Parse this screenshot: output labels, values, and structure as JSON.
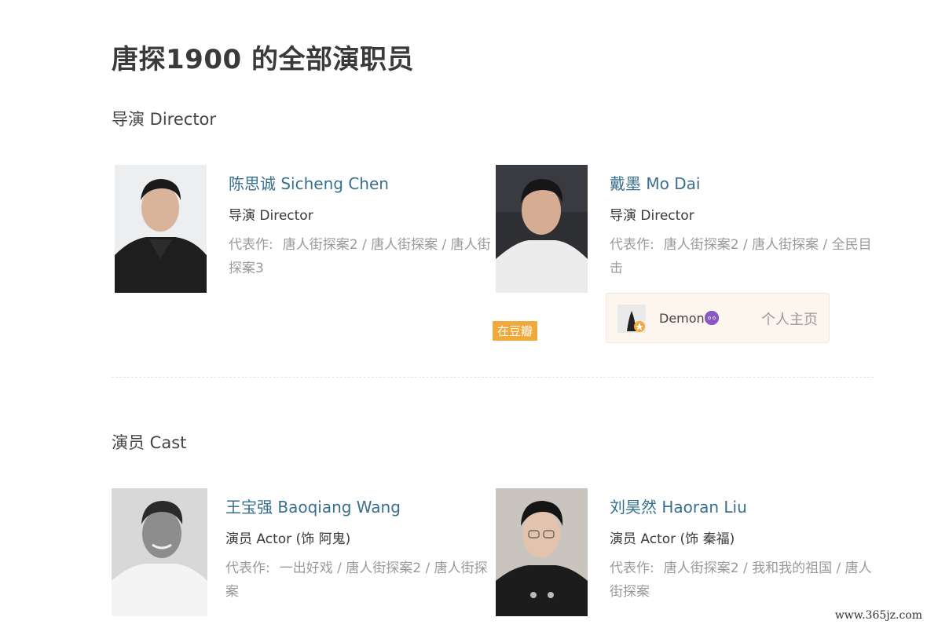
{
  "page": {
    "title": "唐探1900 的全部演职员"
  },
  "sections": [
    {
      "heading": "导演 Director",
      "people": [
        {
          "name": "陈思诚 Sicheng Chen",
          "role": "导演 Director",
          "works_label": "代表作:",
          "works": "唐人街探案2 / 唐人街探案 / 唐人街探案3"
        },
        {
          "name": "戴墨 Mo Dai",
          "role": "导演 Director",
          "works_label": "代表作:",
          "works": "唐人街探案2 / 唐人街探案 / 全民目击",
          "badge": "在豆瓣",
          "user": {
            "name": "Demon",
            "link": "个人主页"
          }
        }
      ]
    },
    {
      "heading": "演员 Cast",
      "people": [
        {
          "name": "王宝强 Baoqiang Wang",
          "role": "演员 Actor (饰 阿鬼)",
          "works_label": "代表作:",
          "works": "一出好戏 / 唐人街探案2 / 唐人街探案"
        },
        {
          "name": "刘昊然 Haoran Liu",
          "role": "演员 Actor (饰 秦福)",
          "works_label": "代表作:",
          "works": "唐人街探案2 / 我和我的祖国 / 唐人街探案"
        }
      ]
    }
  ],
  "watermark": "www.365jz.com"
}
